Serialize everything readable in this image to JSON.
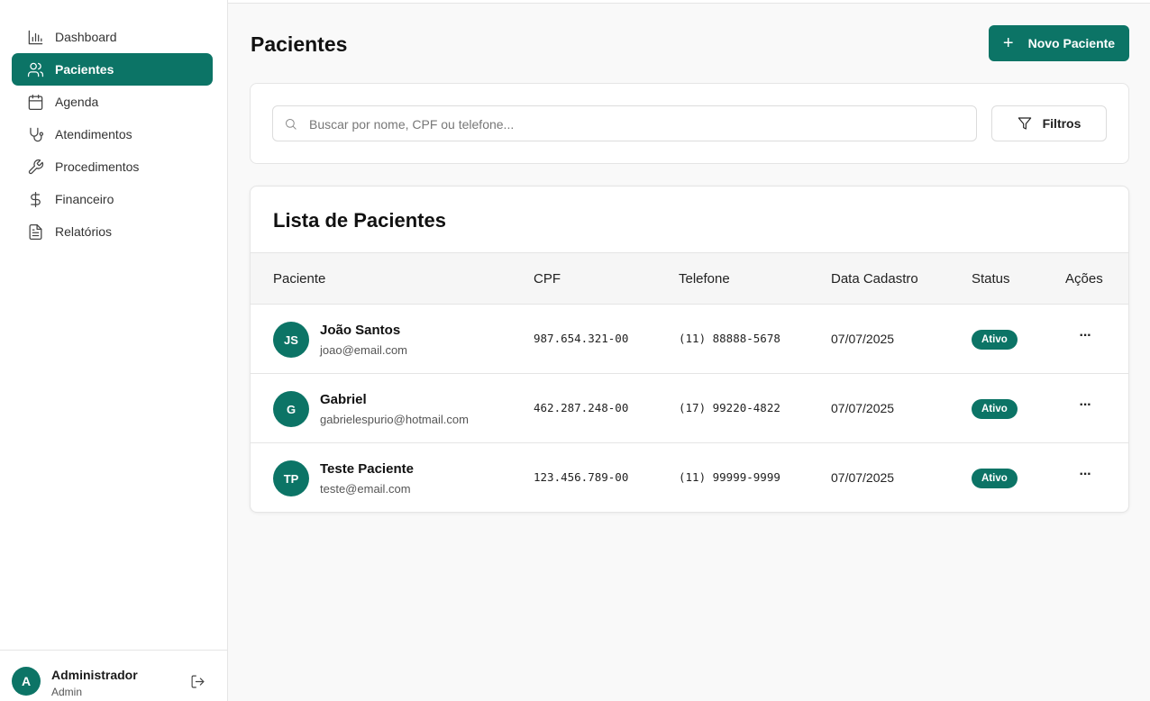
{
  "sidebar": {
    "items": [
      {
        "label": "Dashboard",
        "icon": "bar-chart-icon",
        "active": false
      },
      {
        "label": "Pacientes",
        "icon": "users-icon",
        "active": true
      },
      {
        "label": "Agenda",
        "icon": "calendar-icon",
        "active": false
      },
      {
        "label": "Atendimentos",
        "icon": "stethoscope-icon",
        "active": false
      },
      {
        "label": "Procedimentos",
        "icon": "wrench-icon",
        "active": false
      },
      {
        "label": "Financeiro",
        "icon": "dollar-icon",
        "active": false
      },
      {
        "label": "Relatórios",
        "icon": "file-text-icon",
        "active": false
      }
    ],
    "user": {
      "initial": "A",
      "name": "Administrador",
      "role": "Admin"
    }
  },
  "header": {
    "title": "Pacientes",
    "new_button_label": "Novo Paciente"
  },
  "filters": {
    "search_placeholder": "Buscar por nome, CPF ou telefone...",
    "search_value": "",
    "filter_button_label": "Filtros"
  },
  "list": {
    "title": "Lista de Pacientes",
    "columns": [
      "Paciente",
      "CPF",
      "Telefone",
      "Data Cadastro",
      "Status",
      "Ações"
    ],
    "rows": [
      {
        "initials": "JS",
        "name": "João Santos",
        "email": "joao@email.com",
        "cpf": "987.654.321-00",
        "phone": "(11) 88888-5678",
        "date": "07/07/2025",
        "status": "Ativo",
        "actions": "···"
      },
      {
        "initials": "G",
        "name": "Gabriel",
        "email": "gabrielespurio@hotmail.com",
        "cpf": "462.287.248-00",
        "phone": "(17) 99220-4822",
        "date": "07/07/2025",
        "status": "Ativo",
        "actions": "···"
      },
      {
        "initials": "TP",
        "name": "Teste Paciente",
        "email": "teste@email.com",
        "cpf": "123.456.789-00",
        "phone": "(11) 99999-9999",
        "date": "07/07/2025",
        "status": "Ativo",
        "actions": "···"
      }
    ]
  },
  "colors": {
    "primary": "#0c7466",
    "background": "#f9f9f9",
    "border": "#e5e5e5"
  }
}
